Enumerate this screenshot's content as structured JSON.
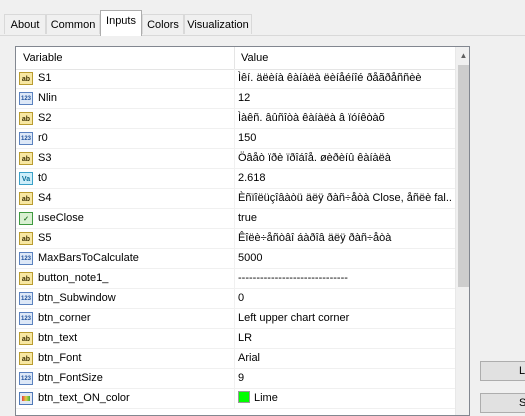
{
  "tabs": [
    {
      "label": "About",
      "active": false
    },
    {
      "label": "Common",
      "active": false
    },
    {
      "label": "Inputs",
      "active": true
    },
    {
      "label": "Colors",
      "active": false
    },
    {
      "label": "Visualization",
      "active": false
    }
  ],
  "table": {
    "headers": {
      "variable": "Variable",
      "value": "Value"
    },
    "rows": [
      {
        "type": "string-icon",
        "name": "S1",
        "value": "Ìêí. äëèíà êàíàëà ëèíåéíîé ðåãðåññèè"
      },
      {
        "type": "integer-icon",
        "name": "Nlin",
        "value": "12"
      },
      {
        "type": "string-icon",
        "name": "S2",
        "value": "Ìàêñ. âûñîòà êàíàëà â ïóíêòàõ"
      },
      {
        "type": "integer-icon",
        "name": "r0",
        "value": "150"
      },
      {
        "type": "string-icon",
        "name": "S3",
        "value": "Öâåò ïðè ïðîáîå. øèðèíû êàíàëà"
      },
      {
        "type": "double-icon",
        "name": "t0",
        "value": "2.618"
      },
      {
        "type": "string-icon",
        "name": "S4",
        "value": "Èñïîëüçîâàòü äëÿ ðàñ÷åòà Close, åñëè fal..."
      },
      {
        "type": "bool-icon",
        "name": "useClose",
        "value": "true"
      },
      {
        "type": "string-icon",
        "name": "S5",
        "value": "Êîëè÷åñòâî áàðîâ äëÿ ðàñ÷åòà"
      },
      {
        "type": "integer-icon",
        "name": "MaxBarsToCalculate",
        "value": "5000"
      },
      {
        "type": "string-icon",
        "name": "button_note1_",
        "value": "------------------------------"
      },
      {
        "type": "integer-icon",
        "name": "btn_Subwindow",
        "value": "0"
      },
      {
        "type": "integer-icon",
        "name": "btn_corner",
        "value": "Left upper chart corner"
      },
      {
        "type": "string-icon",
        "name": "btn_text",
        "value": "LR"
      },
      {
        "type": "string-icon",
        "name": "btn_Font",
        "value": "Arial"
      },
      {
        "type": "integer-icon",
        "name": "btn_FontSize",
        "value": "9"
      },
      {
        "type": "color-icon",
        "name": "btn_text_ON_color",
        "value": "Lime",
        "swatch": "#00ff00"
      }
    ]
  },
  "side_buttons": [
    {
      "label": "L"
    },
    {
      "label": "S"
    }
  ]
}
